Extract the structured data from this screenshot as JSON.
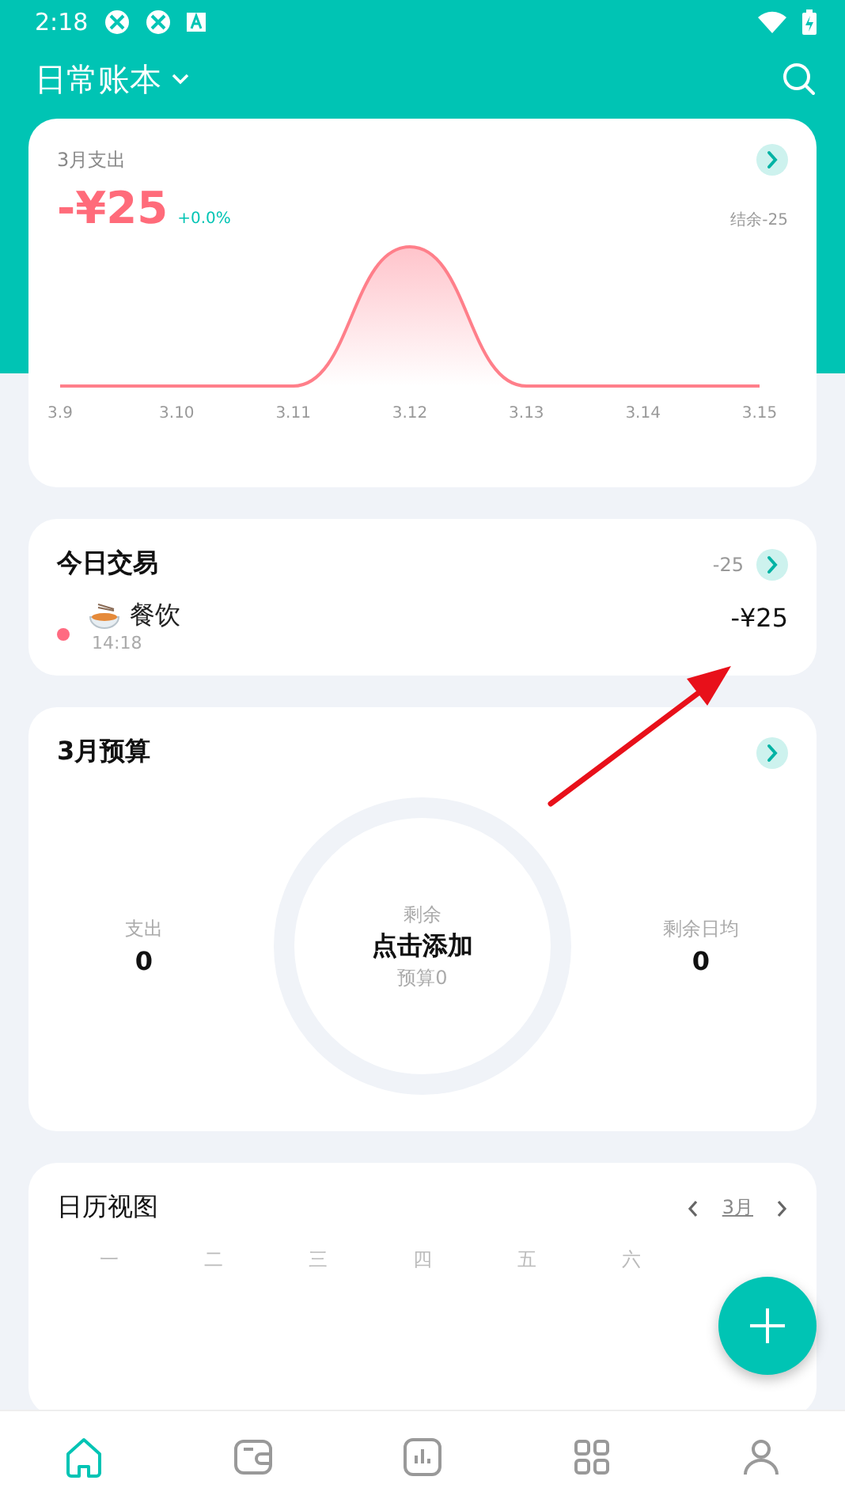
{
  "status_bar": {
    "time": "2:18"
  },
  "header": {
    "title": "日常账本"
  },
  "expense_card": {
    "label": "3月支出",
    "amount": "-¥25",
    "change": "+0.0%",
    "balance": "结余-25",
    "x_labels": [
      "3.9",
      "3.10",
      "3.11",
      "3.12",
      "3.13",
      "3.14",
      "3.15"
    ]
  },
  "today_card": {
    "title": "今日交易",
    "total": "-25",
    "transactions": [
      {
        "category": "餐饮",
        "time": "14:18",
        "amount": "-¥25",
        "color": "#ff6b81"
      }
    ]
  },
  "budget_card": {
    "title": "3月预算",
    "spent_label": "支出",
    "spent": "0",
    "remaining_label": "剩余",
    "action": "点击添加",
    "budget": "预算0",
    "daily_label": "剩余日均",
    "daily": "0"
  },
  "calendar_card": {
    "title": "日历视图",
    "month": "3月",
    "weekdays": [
      "一",
      "二",
      "三",
      "四",
      "五",
      "六"
    ]
  },
  "bottom_nav": [
    {
      "kind": "home",
      "selected": true
    },
    {
      "kind": "wallet",
      "selected": false
    },
    {
      "kind": "stats",
      "selected": false
    },
    {
      "kind": "apps",
      "selected": false
    },
    {
      "kind": "profile",
      "selected": false
    }
  ]
}
